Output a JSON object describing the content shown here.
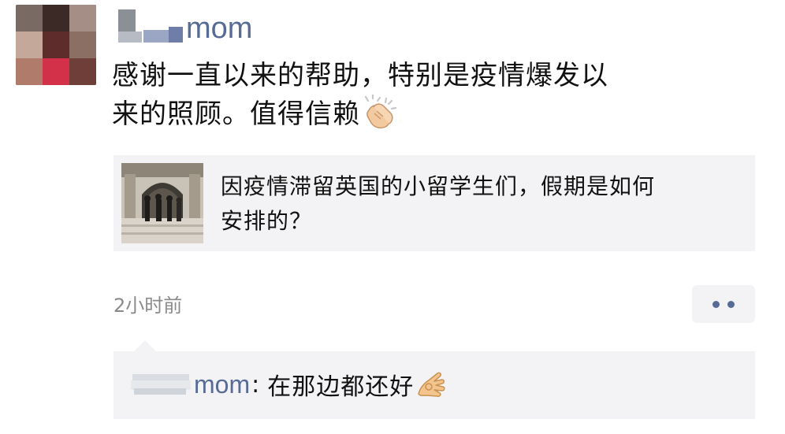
{
  "post": {
    "author_suffix": "mom",
    "text_line1": "感谢一直以来的帮助，特别是疫情爆发以",
    "text_line2": "来的照顾。值得信赖",
    "text_emoji": "clapping-hands-icon",
    "link_card": {
      "title_line1": "因疫情滞留英国的小留学生们，假期是如何",
      "title_line2": "安排的？"
    },
    "time": "2小时前",
    "more_icon": "more-dots-icon"
  },
  "comments": [
    {
      "author_suffix": "mom",
      "separator": ":",
      "text": "在那边都还好",
      "emoji": "ok-hand-icon"
    }
  ],
  "colors": {
    "name_link": "#576b95",
    "card_bg": "#f3f3f5",
    "meta_text": "#8a8a8a"
  }
}
